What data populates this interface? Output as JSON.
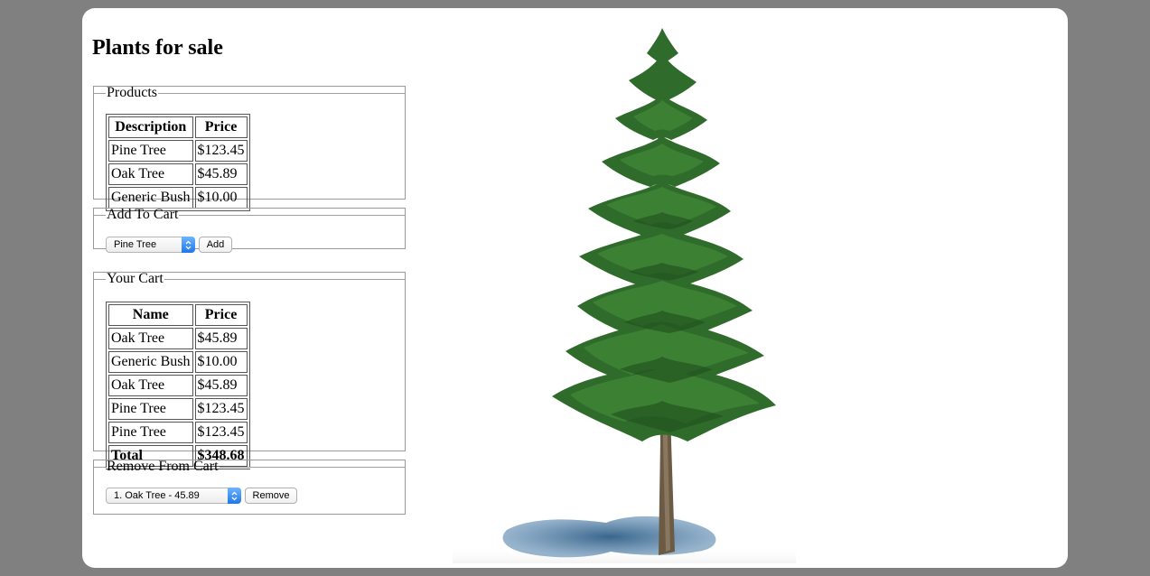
{
  "page": {
    "title": "Plants for sale"
  },
  "products": {
    "legend": "Products",
    "headers": [
      "Description",
      "Price"
    ],
    "rows": [
      {
        "name": "Pine Tree",
        "price": "$123.45"
      },
      {
        "name": "Oak Tree",
        "price": "$45.89"
      },
      {
        "name": "Generic Bush",
        "price": "$10.00"
      }
    ]
  },
  "add_to_cart": {
    "legend": "Add To Cart",
    "selected": "Pine Tree",
    "button_label": "Add"
  },
  "cart": {
    "legend": "Your Cart",
    "headers": [
      "Name",
      "Price"
    ],
    "rows": [
      {
        "name": "Oak Tree",
        "price": "$45.89"
      },
      {
        "name": "Generic Bush",
        "price": "$10.00"
      },
      {
        "name": "Oak Tree",
        "price": "$45.89"
      },
      {
        "name": "Pine Tree",
        "price": "$123.45"
      },
      {
        "name": "Pine Tree",
        "price": "$123.45"
      }
    ],
    "total_label": "Total",
    "total_value": "$348.68"
  },
  "remove_from_cart": {
    "legend": "Remove From Cart",
    "selected": "1. Oak Tree - 45.89",
    "button_label": "Remove"
  },
  "colors": {
    "backdrop": "#808080",
    "card": "#ffffff",
    "select_arrow": "#2a7ff0",
    "foliage": "#2f6b2a",
    "trunk": "#6b5a44",
    "shadow": "#3a6a94"
  },
  "icons": {
    "tree_image": "pine-tree-image",
    "select_arrow": "chevron-updown-icon"
  }
}
